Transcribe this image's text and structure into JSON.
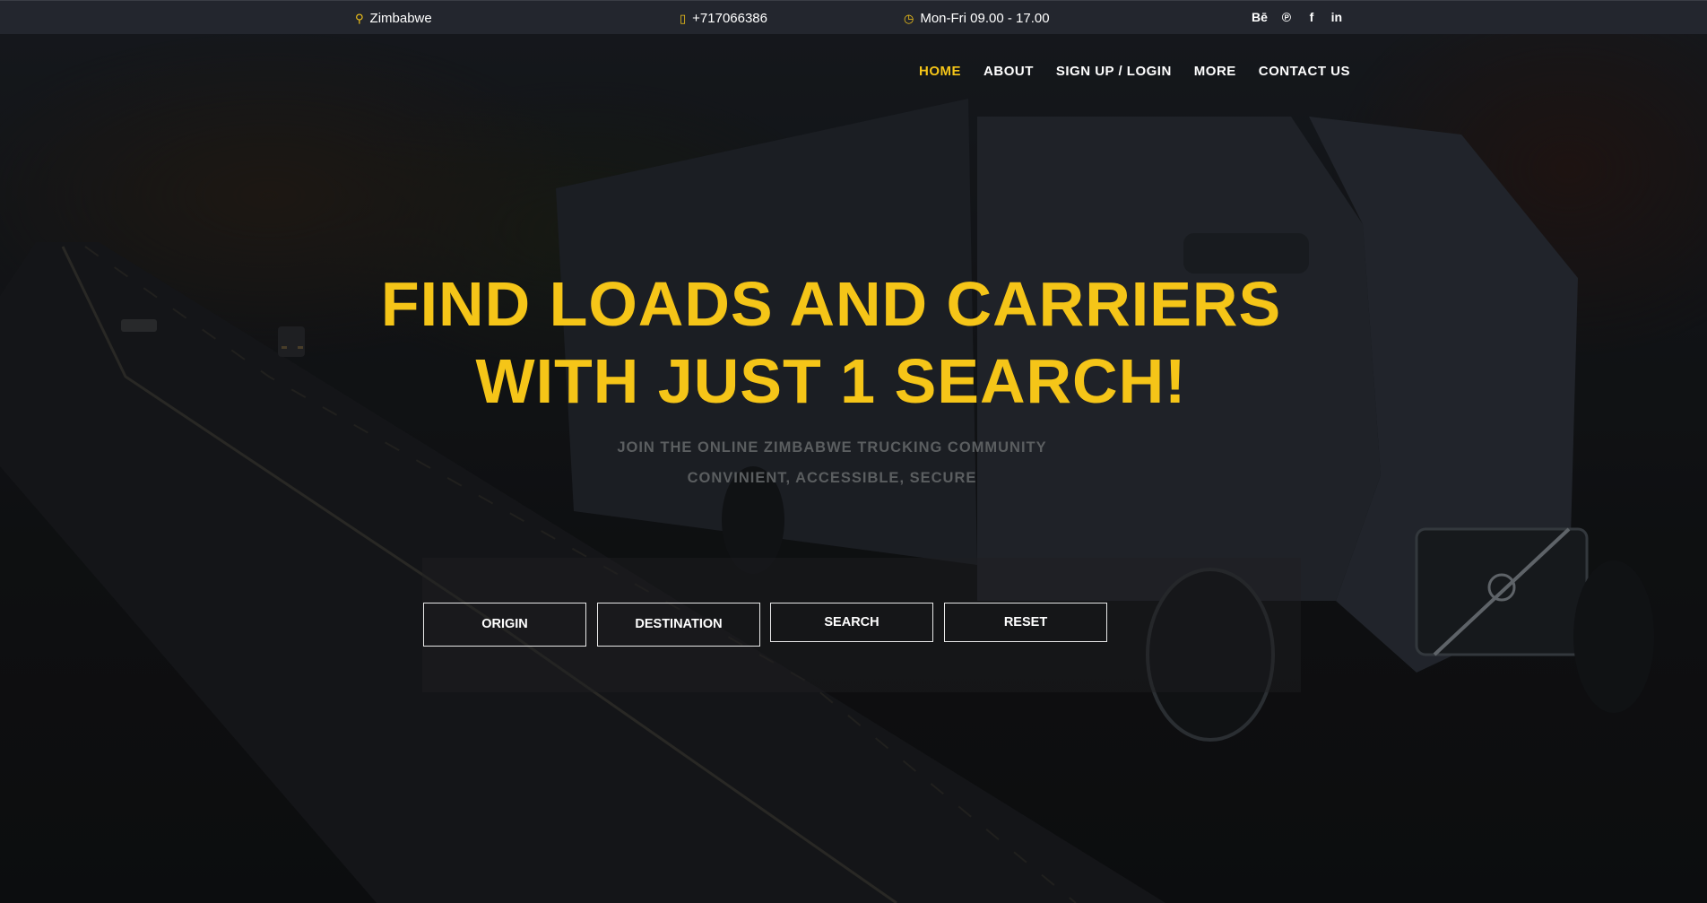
{
  "topbar": {
    "location": "Zimbabwe",
    "phone": "+717066386",
    "hours": "Mon-Fri 09.00 - 17.00",
    "location_icon": "map-pin-icon",
    "phone_icon": "mobile-phone-icon",
    "hours_icon": "clock-icon",
    "social": [
      {
        "icon": "behance-icon",
        "glyph": "Bē"
      },
      {
        "icon": "pinterest-icon",
        "glyph": "℗"
      },
      {
        "icon": "facebook-icon",
        "glyph": "f"
      },
      {
        "icon": "linkedin-icon",
        "glyph": "in"
      }
    ]
  },
  "nav": {
    "items": [
      {
        "label": "HOME",
        "active": true
      },
      {
        "label": "ABOUT",
        "active": false
      },
      {
        "label": "SIGN UP / LOGIN",
        "active": false
      },
      {
        "label": "MORE",
        "active": false
      },
      {
        "label": "CONTACT US",
        "active": false
      }
    ]
  },
  "hero": {
    "title_line1": "FIND LOADS AND CARRIERS",
    "title_line2": "WITH JUST 1 SEARCH!",
    "subtitle_line1": "JOIN THE ONLINE ZIMBABWE TRUCKING COMMUNITY",
    "subtitle_line2": "CONVINIENT, ACCESSIBLE, SECURE"
  },
  "search": {
    "origin_label": "ORIGIN",
    "destination_label": "DESTINATION",
    "search_label": "SEARCH",
    "reset_label": "RESET"
  },
  "colors": {
    "accent": "#f5c518",
    "topbar_bg": "#23262e",
    "text": "#ffffff"
  }
}
